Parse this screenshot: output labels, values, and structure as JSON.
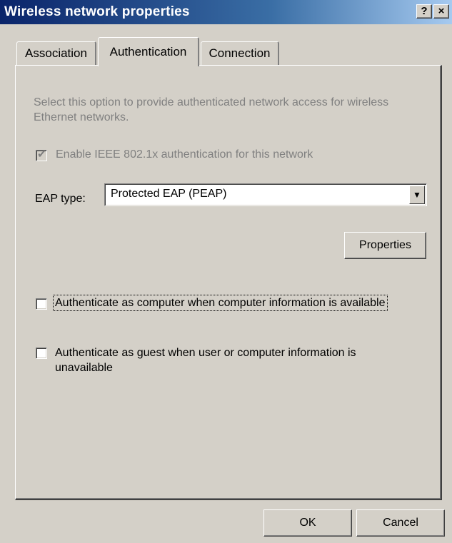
{
  "window": {
    "title": "Wireless network properties",
    "help_label": "?",
    "close_label": "×"
  },
  "tabs": [
    {
      "label": "Association",
      "selected": false
    },
    {
      "label": "Authentication",
      "selected": true
    },
    {
      "label": "Connection",
      "selected": false
    }
  ],
  "authentication": {
    "description": "Select this option to provide authenticated network access for wireless Ethernet networks.",
    "enable_8021x": {
      "label": "Enable IEEE 802.1x authentication for this network",
      "checked": true,
      "disabled": true
    },
    "eap_type_label": "EAP type:",
    "eap_type_value": "Protected EAP (PEAP)",
    "properties_label": "Properties",
    "auth_as_computer": {
      "label": "Authenticate as computer when computer information is available",
      "checked": false
    },
    "auth_as_guest": {
      "label": "Authenticate as guest when user or computer information is unavailable",
      "checked": false
    }
  },
  "footer": {
    "ok_label": "OK",
    "cancel_label": "Cancel"
  },
  "colors": {
    "titlebar_start": "#0a246a",
    "titlebar_end": "#a6caf0",
    "dialog_face": "#d4d0c8",
    "disabled_text": "#808080"
  }
}
